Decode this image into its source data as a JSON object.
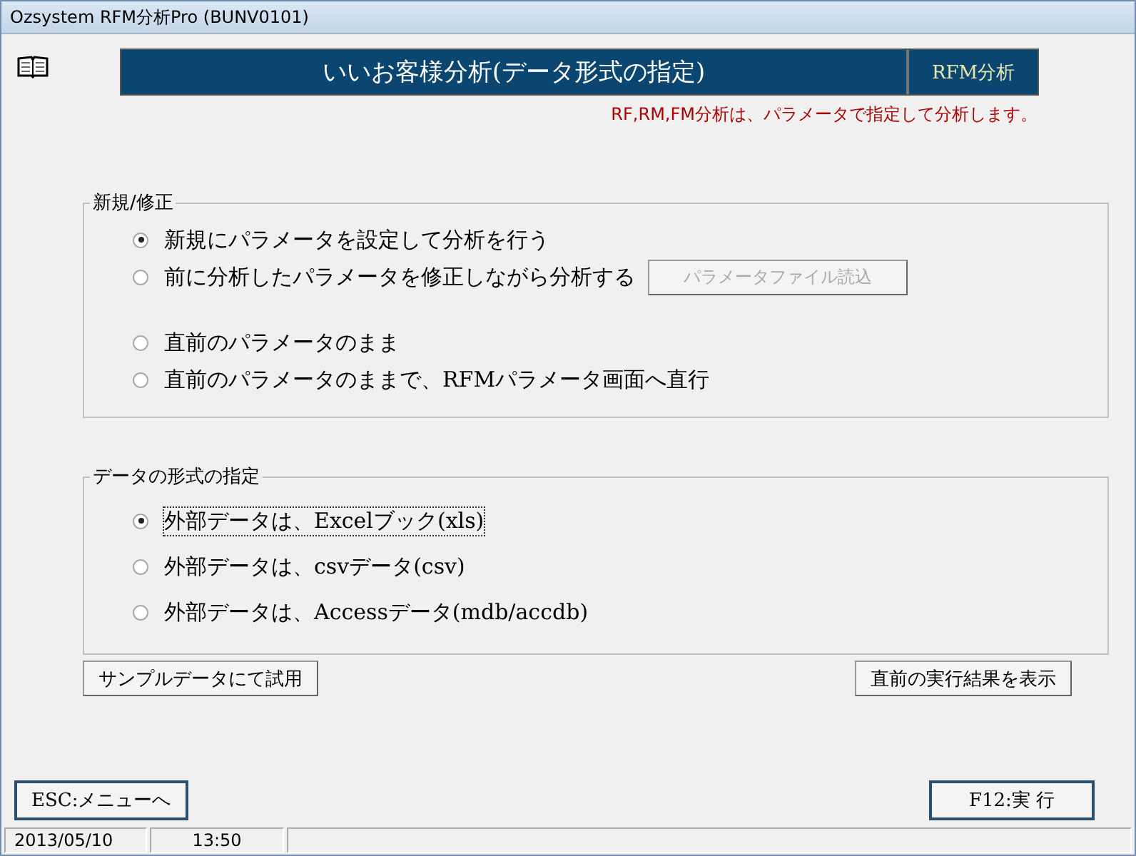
{
  "window": {
    "title": "Ozsystem RFM分析Pro (BUNV0101)"
  },
  "header": {
    "title": "いいお客様分析(データ形式の指定)",
    "badge": "RFM分析",
    "note": "RF,RM,FM分析は、パラメータで指定して分析します。"
  },
  "mode_group": {
    "label": "新規/修正",
    "options": [
      {
        "label": "新規にパラメータを設定して分析を行う",
        "selected": true
      },
      {
        "label": "前に分析したパラメータを修正しながら分析する",
        "selected": false,
        "button": {
          "label": "パラメータファイル読込",
          "disabled": true
        }
      },
      {
        "label": "直前のパラメータのまま",
        "selected": false,
        "gap": true
      },
      {
        "label": "直前のパラメータのままで、RFMパラメータ画面へ直行",
        "selected": false
      }
    ]
  },
  "format_group": {
    "label": "データの形式の指定",
    "options": [
      {
        "label": "外部データは、Excelブック(xls)",
        "selected": true
      },
      {
        "label": "外部データは、csvデータ(csv)",
        "selected": false
      },
      {
        "label": "外部データは、Accessデータ(mdb/accdb)",
        "selected": false
      }
    ]
  },
  "actions": [
    "サンプルデータにて試用",
    "直前の実行結果を表示"
  ],
  "footer_buttons": [
    "ESC:メニューへ",
    "F12:実 行"
  ],
  "status_bar": [
    "2013/05/10",
    "13:50"
  ]
}
